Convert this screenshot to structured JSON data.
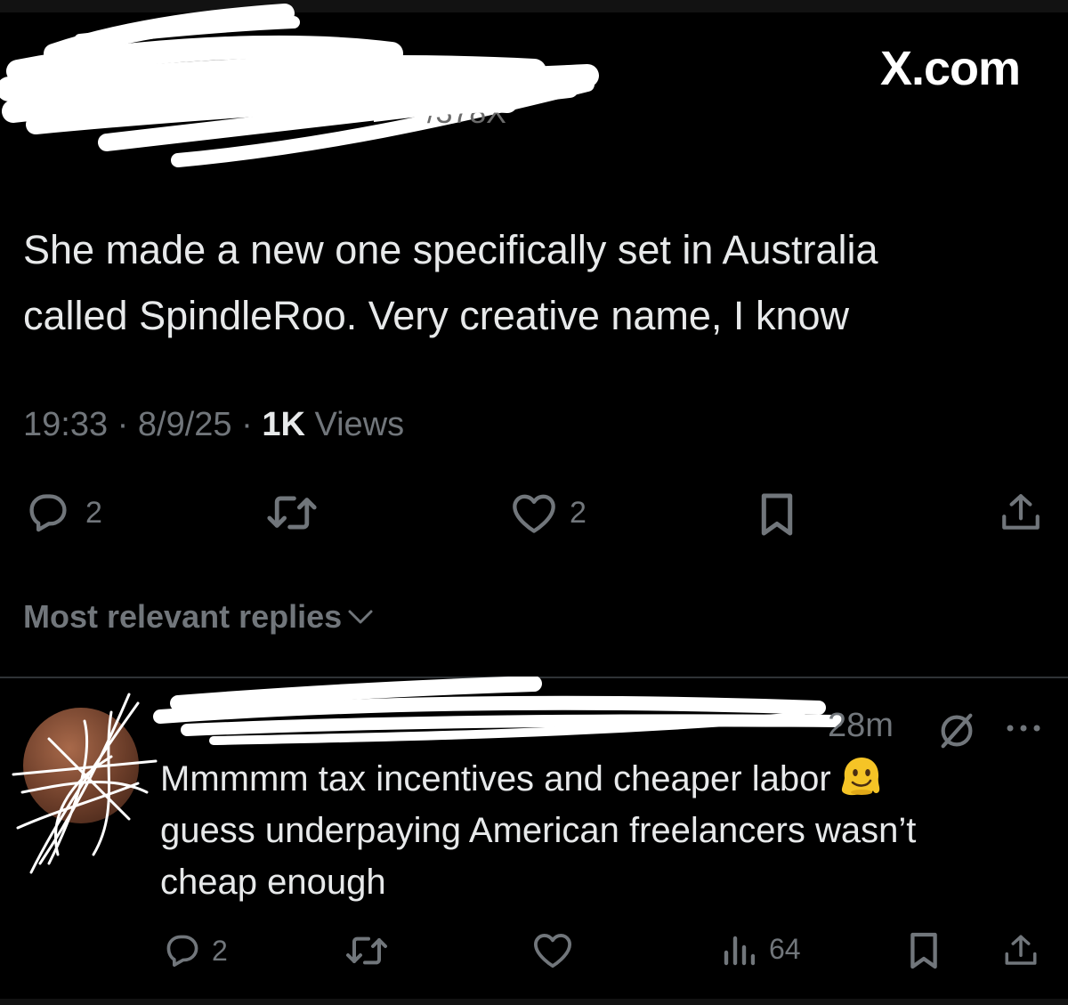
{
  "watermark": "X.com",
  "tweet": {
    "handle_fragment": "/378X",
    "text_line1": "She made a new one specifically set in Australia",
    "text_line2": "called SpindleRoo. Very creative name, I know",
    "time": "19:33",
    "date": "8/9/25",
    "views_count": "1K",
    "views_label": "Views",
    "separator": "·",
    "actions": {
      "reply_count": "2",
      "like_count": "2"
    }
  },
  "replies_filter": {
    "label": "Most relevant replies"
  },
  "reply": {
    "time": "28m",
    "text_line1": "Mmmmm tax incentives and cheaper labor",
    "text_line2": "guess underpaying American freelancers wasn’t",
    "text_line3": "cheap enough",
    "emoji": "melting-face",
    "actions": {
      "reply_count": "2",
      "views_count": "64"
    }
  },
  "colors": {
    "background": "#000000",
    "text": "#e7e9ea",
    "muted": "#71767b",
    "divider": "#2f3336"
  }
}
